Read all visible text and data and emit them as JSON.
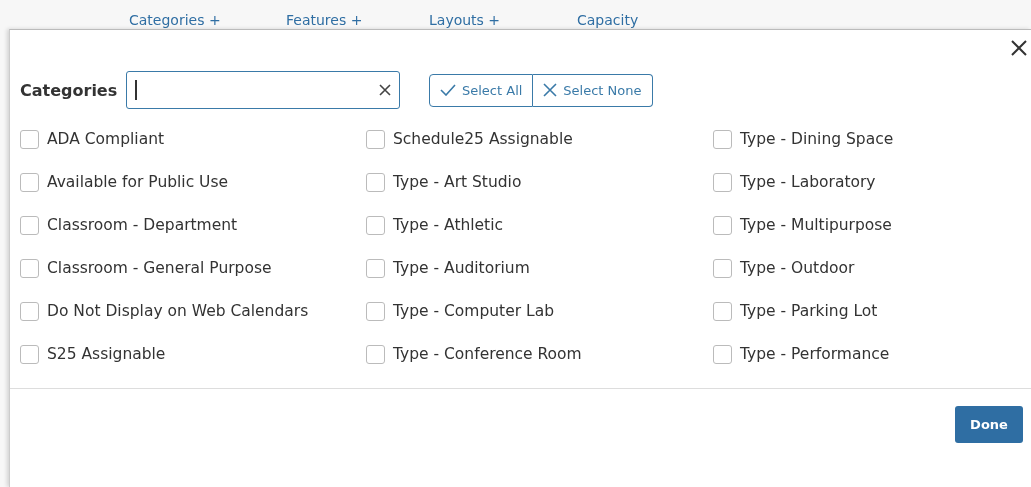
{
  "top_tabs": [
    "Categories +",
    "Features +",
    "Layouts +",
    "Capacity"
  ],
  "dialog": {
    "label": "Categories",
    "select_all": "Select All",
    "select_none": "Select None",
    "options": [
      {
        "label": "ADA Compliant",
        "checked": false
      },
      {
        "label": "Available for Public Use",
        "checked": false
      },
      {
        "label": "Classroom - Department",
        "checked": false
      },
      {
        "label": "Classroom - General Purpose",
        "checked": false
      },
      {
        "label": "Do Not Display on Web Calendars",
        "checked": false
      },
      {
        "label": "S25 Assignable",
        "checked": false
      },
      {
        "label": "Schedule25 Assignable",
        "checked": false
      },
      {
        "label": "Type - Art Studio",
        "checked": false
      },
      {
        "label": "Type - Athletic",
        "checked": false
      },
      {
        "label": "Type - Auditorium",
        "checked": false
      },
      {
        "label": "Type - Computer Lab",
        "checked": false
      },
      {
        "label": "Type - Conference Room",
        "checked": false
      },
      {
        "label": "Type - Dining Space",
        "checked": false
      },
      {
        "label": "Type - Laboratory",
        "checked": false
      },
      {
        "label": "Type - Multipurpose",
        "checked": false
      },
      {
        "label": "Type - Outdoor",
        "checked": false
      },
      {
        "label": "Type - Parking Lot",
        "checked": false
      },
      {
        "label": "Type - Performance",
        "checked": false
      }
    ],
    "done": "Done"
  }
}
